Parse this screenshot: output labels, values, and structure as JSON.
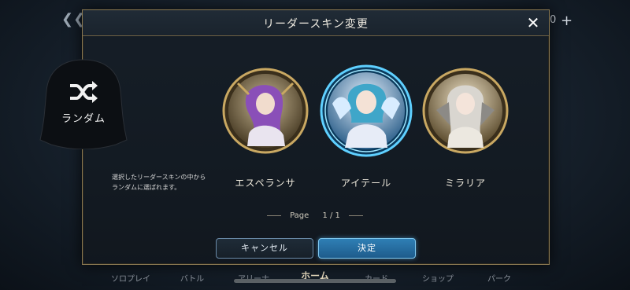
{
  "background": {
    "back_icon": "back-arrow-icon",
    "counter": "0",
    "plus_icon": "plus-icon",
    "nav": [
      "ソロプレイ",
      "バトル",
      "アリーナ",
      "ホーム",
      "カード",
      "ショップ",
      "パーク"
    ],
    "active_nav": "ホーム"
  },
  "modal": {
    "title": "リーダースキン変更",
    "close_icon": "close-icon",
    "random": {
      "label": "ランダム",
      "icon": "shuffle-icon",
      "description": [
        "選択したリーダースキンの中から",
        "ランダムに選ばれます。"
      ]
    },
    "skins": [
      {
        "name": "エスペランサ",
        "selected": false
      },
      {
        "name": "アイテール",
        "selected": true
      },
      {
        "name": "ミラリア",
        "selected": false
      }
    ],
    "pager": {
      "label": "Page",
      "value": "1 / 1"
    },
    "cancel_label": "キャンセル",
    "confirm_label": "決定"
  },
  "colors": {
    "frame_gold": "#b89a5a",
    "selected_glow": "#5fd0ff",
    "confirm_blue": "#2f7fb5"
  }
}
